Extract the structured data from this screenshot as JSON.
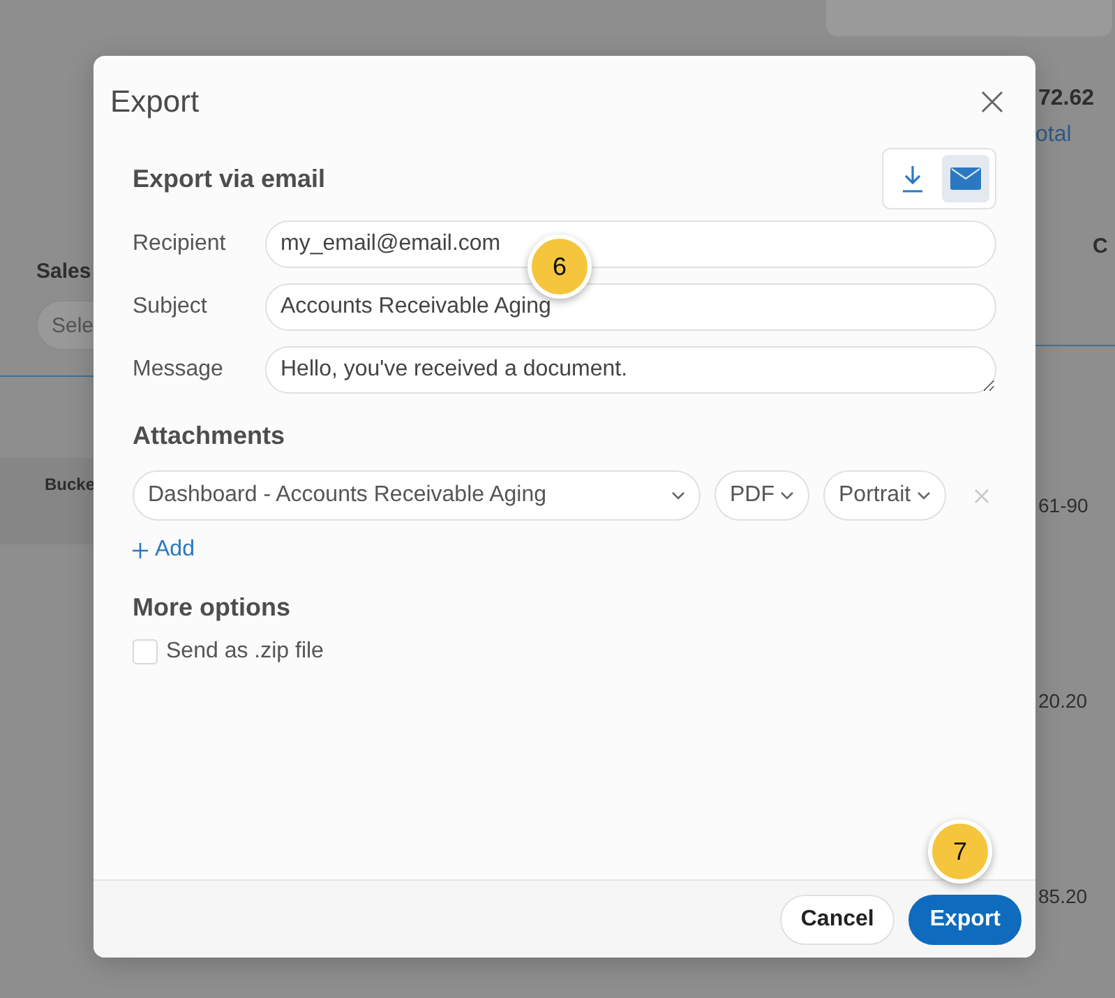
{
  "background": {
    "left": {
      "filter_label": "Sales",
      "filter_placeholder": "Sele",
      "column_header": "Bucke"
    },
    "right": {
      "amount": "72.62",
      "caption": "otal",
      "filter_label": "C",
      "cells": [
        "61-90",
        "20.20",
        "85.20"
      ]
    }
  },
  "dialog": {
    "title": "Export",
    "section_title": "Export via email",
    "modes": [
      {
        "kind": "download",
        "selected": false
      },
      {
        "kind": "email",
        "selected": true
      }
    ],
    "fields": [
      {
        "label": "Recipient",
        "value": "my_email@email.com",
        "kind": "input"
      },
      {
        "label": "Subject",
        "value": "Accounts Receivable Aging",
        "kind": "input"
      },
      {
        "label": "Message",
        "value": "Hello, you've received a document.",
        "kind": "textarea"
      }
    ],
    "attachments_title": "Attachments",
    "attachment": {
      "document": "Dashboard - Accounts Receivable Aging",
      "format": "PDF",
      "orientation": "Portrait"
    },
    "add_label": "Add",
    "more_options_title": "More options",
    "options": [
      {
        "label": "Send as .zip file",
        "checked": false
      }
    ],
    "buttons": [
      {
        "label": "Cancel",
        "kind": "secondary"
      },
      {
        "label": "Export",
        "kind": "primary"
      }
    ]
  },
  "step_markers": [
    {
      "number": "6"
    },
    {
      "number": "7"
    }
  ]
}
